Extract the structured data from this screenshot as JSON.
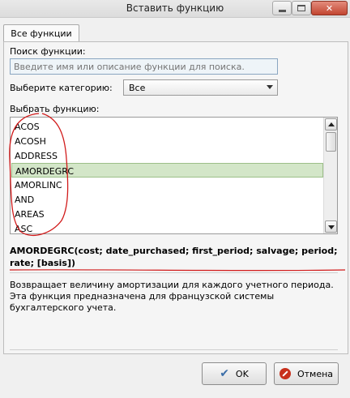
{
  "window": {
    "title": "Вставить функцию"
  },
  "tabs": [
    {
      "label": "Все функции"
    }
  ],
  "search": {
    "label": "Поиск функции:",
    "placeholder": "Введите имя или описание функции для поиска."
  },
  "category": {
    "label": "Выберите категорию:",
    "value": "Все"
  },
  "function_list": {
    "label": "Выбрать функцию:",
    "items": [
      "ACOS",
      "ACOSH",
      "ADDRESS",
      "AMORDEGRC",
      "AMORLINC",
      "AND",
      "AREAS",
      "ASC"
    ],
    "selected": "AMORDEGRC"
  },
  "signature": "AMORDEGRC(cost; date_purchased; first_period; salvage; period; rate; [basis])",
  "description": "Возвращает величину амортизации для каждого учетного периода. Эта функция предназначена для французской системы бухгалтерского учета.",
  "buttons": {
    "ok": "OK",
    "cancel": "Отмена"
  },
  "colors": {
    "selection": "#d3e6c8",
    "annotation": "#d11a1a",
    "close_button": "#c24631"
  }
}
